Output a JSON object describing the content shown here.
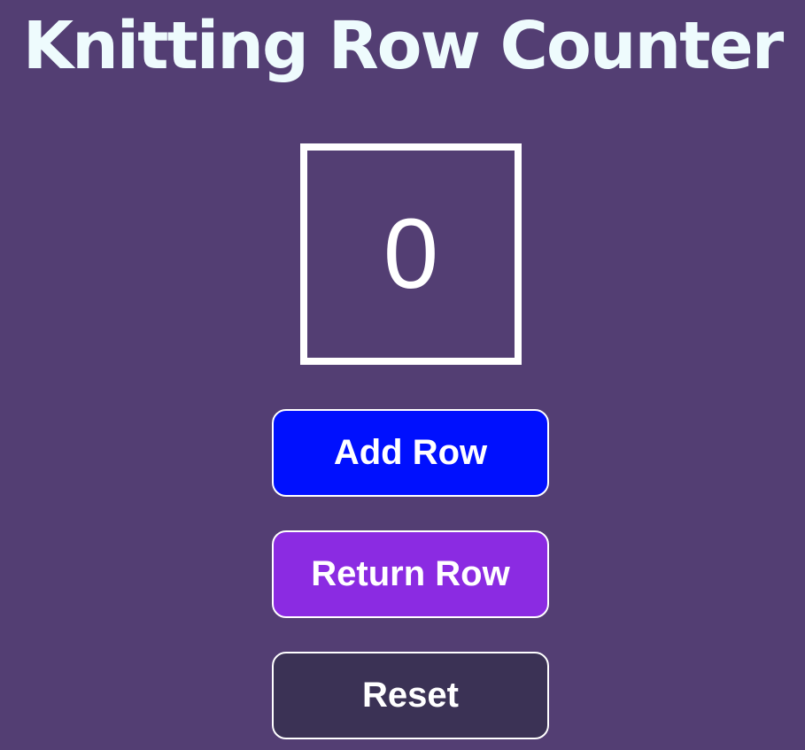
{
  "header": {
    "title": "Knitting Row Counter"
  },
  "counter": {
    "value": "0"
  },
  "buttons": {
    "add_label": "Add Row",
    "return_label": "Return Row",
    "reset_label": "Reset"
  },
  "colors": {
    "background": "#533e73",
    "title_text": "#eefbfd",
    "counter_border": "#ffffff",
    "add_button": "#0010fe",
    "return_button": "#8b2be2",
    "reset_button": "#3b3255"
  }
}
